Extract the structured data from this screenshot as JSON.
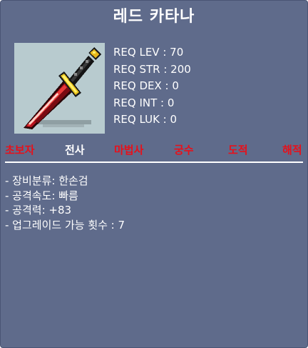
{
  "item": {
    "name": "레드 카타나",
    "icon": "red-katana-sword-icon"
  },
  "requirements": [
    "REQ LEV : 70",
    "REQ STR : 200",
    "REQ DEX : 0",
    "REQ INT : 0",
    "REQ LUK : 0"
  ],
  "jobs": [
    {
      "label": "초보자",
      "color": "#e8101a"
    },
    {
      "label": "전사",
      "color": "#ffffff"
    },
    {
      "label": "마법사",
      "color": "#e8101a"
    },
    {
      "label": "궁수",
      "color": "#e8101a"
    },
    {
      "label": "도적",
      "color": "#e8101a"
    },
    {
      "label": "해적",
      "color": "#e8101a"
    }
  ],
  "stats": [
    "- 장비분류: 한손검",
    "- 공격속도: 빠름",
    "- 공격력: +83",
    "- 업그레이드 가능 횟수 : 7"
  ],
  "colors": {
    "background": "#5f6b8b",
    "text": "#ffffff",
    "unavailable_job": "#e8101a",
    "icon_background": "#b8cbcf"
  }
}
